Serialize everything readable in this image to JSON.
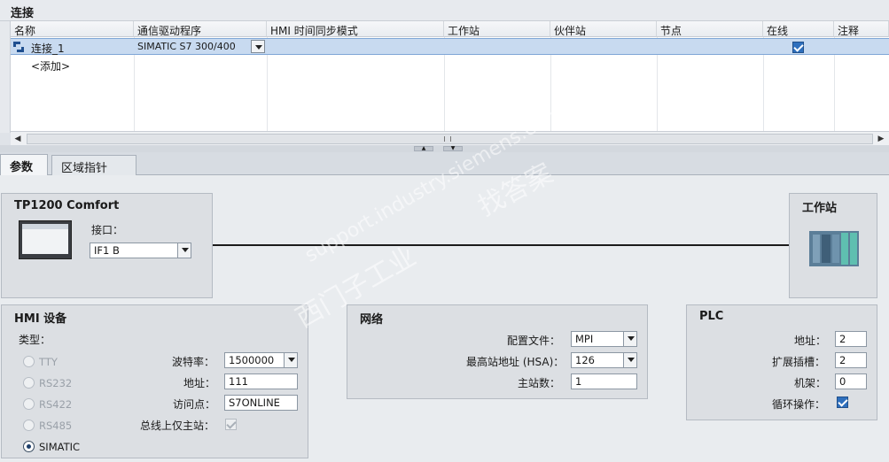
{
  "section_title": "连接",
  "table": {
    "columns": [
      "名称",
      "通信驱动程序",
      "HMI 时间同步模式",
      "工作站",
      "伙伴站",
      "节点",
      "在线",
      "注释"
    ],
    "rows": [
      {
        "name": "连接_1",
        "driver": "SIMATIC S7 300/400",
        "online": true
      }
    ],
    "add_label": "<添加>"
  },
  "tabs": [
    "参数",
    "区域指针"
  ],
  "device": {
    "title": "TP1200 Comfort",
    "interface_label": "接口：",
    "interface_value": "IF1 B"
  },
  "station": {
    "title": "工作站"
  },
  "hmi_device": {
    "title": "HMI 设备",
    "type_label": "类型：",
    "types": [
      "TTY",
      "RS232",
      "RS422",
      "RS485",
      "SIMATIC"
    ],
    "selected_type": "SIMATIC",
    "baud_label": "波特率：",
    "baud_value": "1500000",
    "address_label": "地址：",
    "address_value": "111",
    "access_label": "访问点：",
    "access_value": "S7ONLINE",
    "only_master_label": "总线上仅主站："
  },
  "network": {
    "title": "网络",
    "profile_label": "配置文件：",
    "profile_value": "MPI",
    "hsa_label": "最高站地址 (HSA)：",
    "hsa_value": "126",
    "masters_label": "主站数：",
    "masters_value": "1"
  },
  "plc": {
    "title": "PLC",
    "address_label": "地址：",
    "address_value": "2",
    "slot_label": "扩展插槽：",
    "slot_value": "2",
    "rack_label": "机架：",
    "rack_value": "0",
    "cyclic_label": "循环操作：",
    "cyclic_checked": true
  },
  "watermark": [
    "找答案",
    "support.industry.siemens.com/cs",
    "西门子工业"
  ]
}
